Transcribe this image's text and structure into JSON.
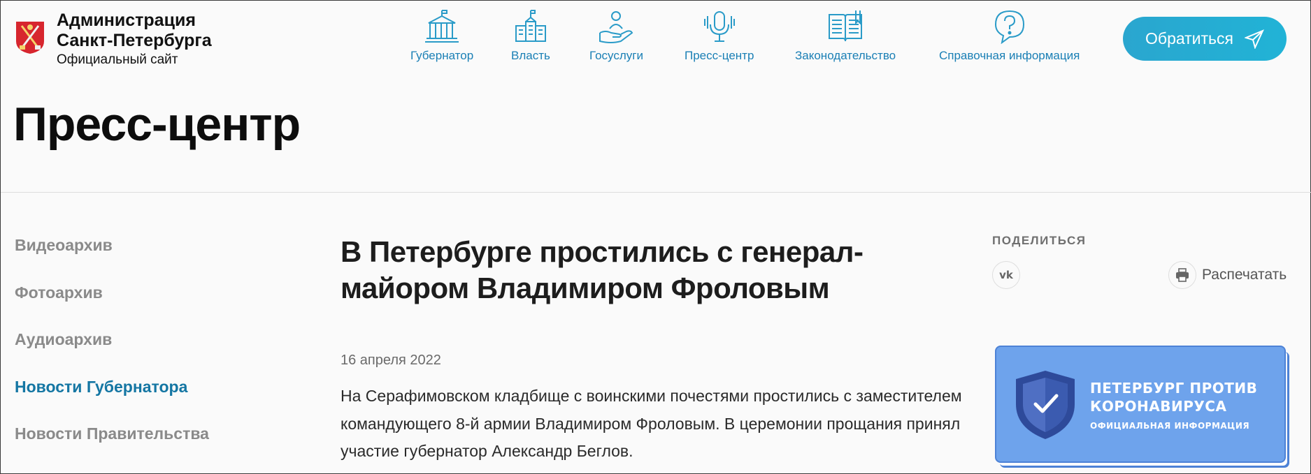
{
  "header": {
    "logo_title_line1": "Администрация",
    "logo_title_line2": "Санкт-Петербурга",
    "logo_subtitle": "Официальный сайт",
    "nav": [
      {
        "label": "Губернатор",
        "icon": "governor-building-icon"
      },
      {
        "label": "Власть",
        "icon": "government-building-icon"
      },
      {
        "label": "Госуслуги",
        "icon": "services-hand-icon"
      },
      {
        "label": "Пресс-центр",
        "icon": "microphone-icon"
      },
      {
        "label": "Законодательство",
        "icon": "law-book-icon"
      },
      {
        "label": "Справочная информация",
        "icon": "help-question-icon"
      }
    ],
    "cta_label": "Обратиться"
  },
  "page_title": "Пресс-центр",
  "sidebar": {
    "items": [
      {
        "label": "Видеоархив",
        "active": false
      },
      {
        "label": "Фотоархив",
        "active": false
      },
      {
        "label": "Аудиоархив",
        "active": false
      },
      {
        "label": "Новости Губернатора",
        "active": true
      },
      {
        "label": "Новости Правительства",
        "active": false
      }
    ]
  },
  "article": {
    "title": "В Петербурге простились с генерал-майором Владимиром Фроловым",
    "date": "16 апреля 2022",
    "body": "На Серафимовском кладбище с воинскими почестями простились с заместителем командующего 8-й армии Владимиром Фроловым. В церемонии прощания принял участие губернатор Александр Беглов."
  },
  "share": {
    "label": "ПОДЕЛИТЬСЯ",
    "vk_label": "vk",
    "print_label": "Распечатать"
  },
  "banner": {
    "title": "Петербург против коронавируса",
    "subtitle": "Официальная информация"
  },
  "colors": {
    "accent": "#1a7fb5",
    "cta": "#21b3d6",
    "active_sidebar": "#1476a3",
    "banner_bg": "#6ea3ec",
    "shield": "#2e4a9a"
  }
}
